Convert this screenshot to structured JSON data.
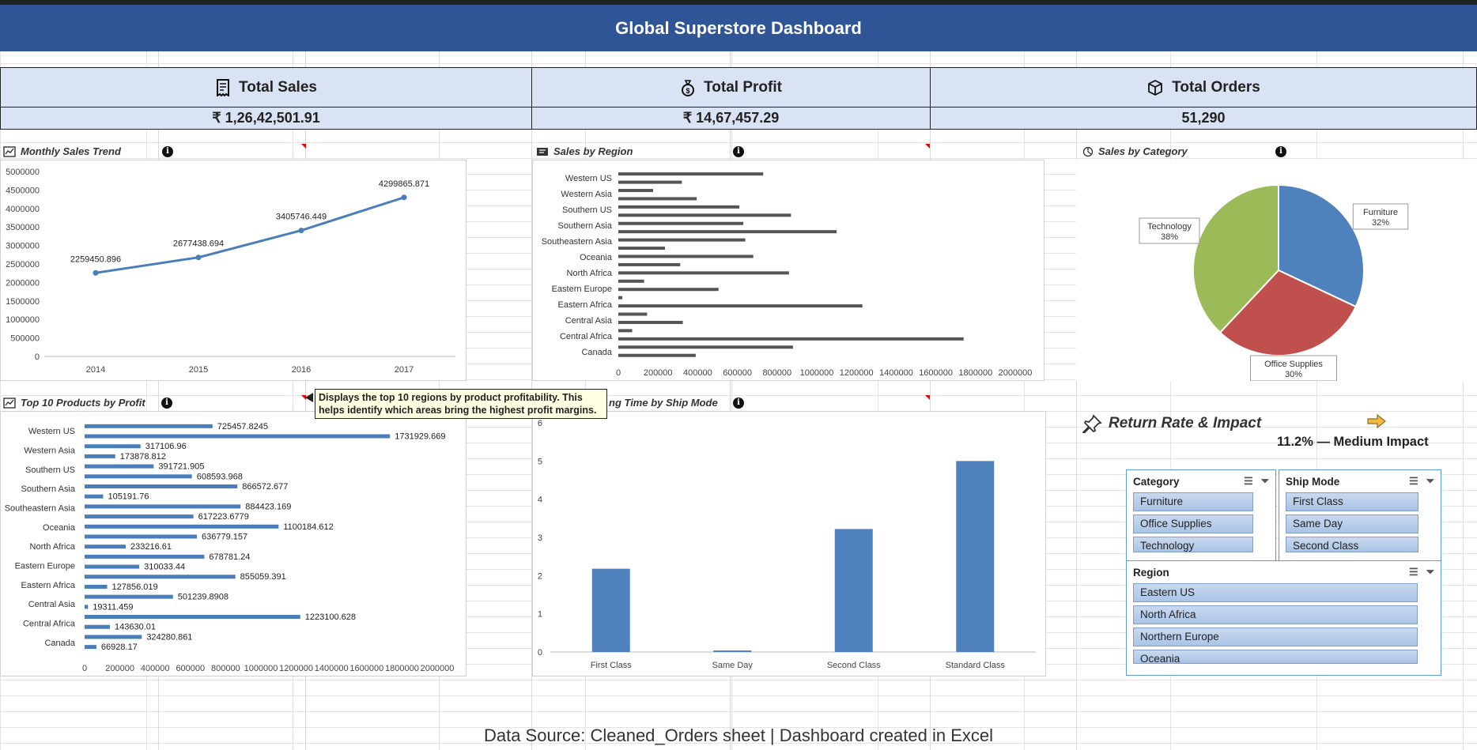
{
  "title": "Global Superstore Dashboard",
  "kpis": [
    {
      "label": "Total Sales",
      "value": "₹ 1,26,42,501.91",
      "icon": "receipt-icon"
    },
    {
      "label": "Total Profit",
      "value": "₹ 14,67,457.29",
      "icon": "money-bag-icon"
    },
    {
      "label": "Total Orders",
      "value": "51,290",
      "icon": "package-icon"
    }
  ],
  "sections": {
    "monthly": "Monthly Sales Trend",
    "region": "Sales by Region",
    "category": "Sales by Category",
    "top10": "Top 10 Products by Profit",
    "shipping": "ng Time by Ship Mode",
    "return_title": "Return Rate & Impact",
    "return_value": "11.2% — Medium Impact"
  },
  "tooltip": "Displays the top 10 regions by product profitability. This helps identify which areas bring the highest profit margins.",
  "info_glyph": "i",
  "chart_data": [
    {
      "type": "line",
      "x": [
        "2014",
        "2015",
        "2016",
        "2017"
      ],
      "values": [
        2259450.896,
        2677438.694,
        3405746.449,
        4299865.871
      ],
      "data_labels": [
        "2259450.896",
        "2677438.694",
        "3405746.449",
        "4299865.871"
      ],
      "y_ticks": [
        "0",
        "500000",
        "1000000",
        "1500000",
        "2000000",
        "2500000",
        "3000000",
        "3500000",
        "4000000",
        "4500000",
        "5000000"
      ],
      "ylim": [
        0,
        5000000
      ],
      "color": "#4a7ebb"
    },
    {
      "type": "bar",
      "orientation": "horizontal",
      "categories": [
        "Western US",
        "Western Asia",
        "Southern US",
        "Southern Asia",
        "Southeastern Asia",
        "Oceania",
        "North Africa",
        "Eastern Europe",
        "Eastern Africa",
        "Central Asia",
        "Central Africa",
        "Canada"
      ],
      "series": [
        {
          "values": [
            730000,
            320000,
            175000,
            395000,
            610000,
            870000,
            630000,
            1100000,
            640000,
            235000,
            680000,
            312000,
            860000,
            130000,
            505000,
            20000,
            1230000,
            145000,
            325000,
            70000,
            1740000,
            880000,
            390000
          ]
        }
      ],
      "x_ticks": [
        "0",
        "200000",
        "400000",
        "600000",
        "800000",
        "1000000",
        "1200000",
        "1400000",
        "1600000",
        "1800000",
        "2000000"
      ],
      "xlim": [
        0,
        2000000
      ],
      "color": "#555555"
    },
    {
      "type": "pie",
      "categories": [
        "Furniture",
        "Office Supplies",
        "Technology"
      ],
      "values": [
        32,
        30,
        38
      ],
      "labels": [
        "32%",
        "30%",
        "38%"
      ],
      "colors": [
        "#4f81bd",
        "#c0504d",
        "#9bbb59"
      ]
    },
    {
      "type": "bar",
      "orientation": "horizontal",
      "categories": [
        "Western US",
        "Western Asia",
        "Southern US",
        "Southern Asia",
        "Southeastern Asia",
        "Oceania",
        "North Africa",
        "Eastern Europe",
        "Eastern Africa",
        "Central Asia",
        "Central Africa",
        "Canada"
      ],
      "values": [
        725457.8245,
        1731929.669,
        317106.96,
        173878.812,
        391721.905,
        608593.968,
        866572.677,
        105191.76,
        884423.169,
        617223.6779,
        1100184.612,
        636779.157,
        233216.61,
        678781.24,
        310033.44,
        855059.391,
        127856.019,
        501239.8908,
        19311.459,
        1223100.628,
        143630.01,
        324280.861,
        66928.17
      ],
      "data_labels": [
        "725457.8245",
        "1731929.669",
        "317106.96",
        "173878.812",
        "391721.905",
        "608593.968",
        "866572.677",
        "105191.76",
        "884423.169",
        "617223.6779",
        "1100184.612",
        "636779.157",
        "233216.61",
        "678781.24",
        "310033.44",
        "855059.391",
        "127856.019",
        "501239.8908",
        "19311.459",
        "1223100.628",
        "143630.01",
        "324280.861",
        "66928.17"
      ],
      "x_ticks": [
        "0",
        "200000",
        "400000",
        "600000",
        "800000",
        "1000000",
        "1200000",
        "1400000",
        "1600000",
        "1800000",
        "2000000"
      ],
      "xlim": [
        0,
        2000000
      ],
      "color": "#4a7ebb"
    },
    {
      "type": "bar",
      "categories": [
        "First Class",
        "Same Day",
        "Second Class",
        "Standard Class"
      ],
      "values": [
        2.18,
        0.04,
        3.22,
        5.0
      ],
      "y_ticks": [
        "0",
        "1",
        "2",
        "3",
        "4",
        "5",
        "6"
      ],
      "ylim": [
        0,
        6
      ],
      "color": "#4f81bd"
    }
  ],
  "slicers": {
    "category": {
      "title": "Category",
      "items": [
        "Furniture",
        "Office Supplies",
        "Technology"
      ]
    },
    "ship_mode": {
      "title": "Ship Mode",
      "items": [
        "First Class",
        "Same Day",
        "Second Class"
      ]
    },
    "region": {
      "title": "Region",
      "items": [
        "Eastern US",
        "North Africa",
        "Northern Europe",
        "Oceania"
      ]
    }
  },
  "footer": "Data Source: Cleaned_Orders sheet  |  Dashboard created in Excel"
}
